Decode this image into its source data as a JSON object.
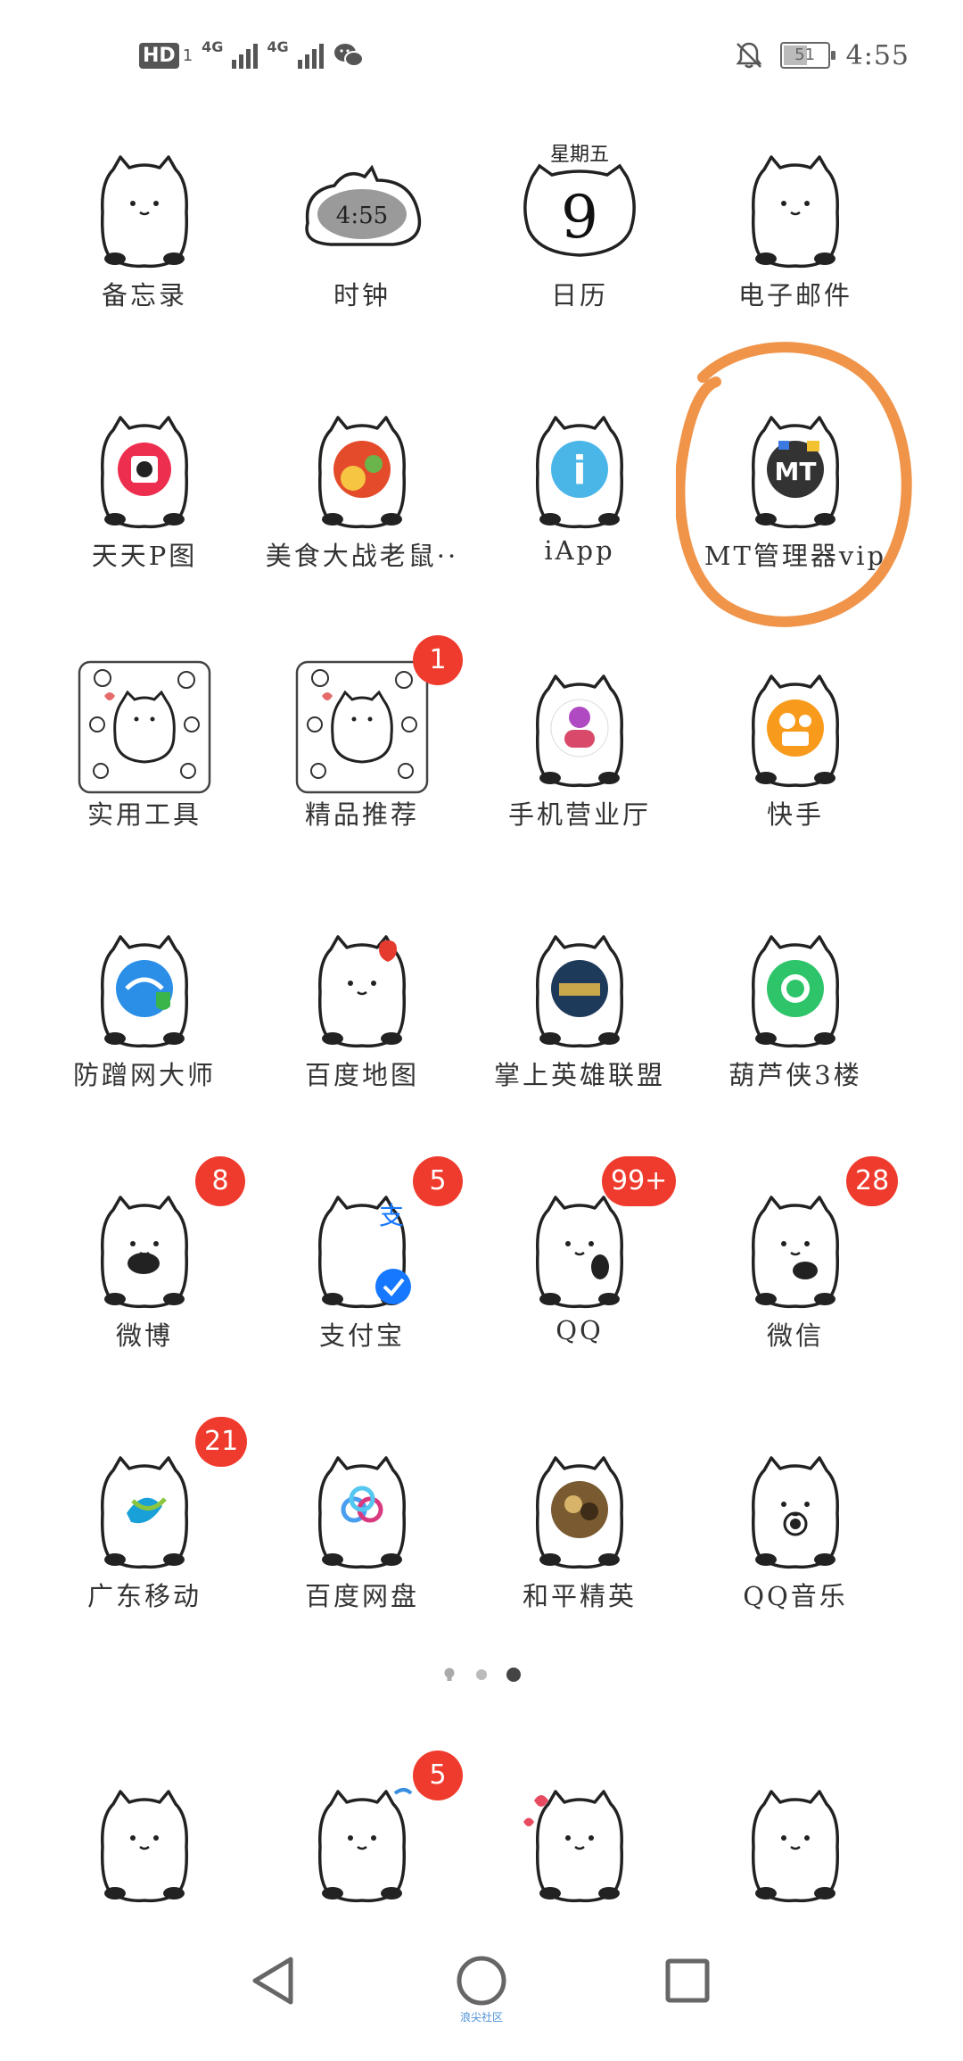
{
  "status_bar": {
    "hd": "HD",
    "sim": "1",
    "net1": "4G",
    "net2": "4G",
    "battery": "51",
    "time": "4:55"
  },
  "apps": [
    {
      "label": "备忘录",
      "icon": "cat-memo-icon"
    },
    {
      "label": "时钟",
      "icon": "cat-clock-icon",
      "clock_text": "4:55"
    },
    {
      "label": "日历",
      "icon": "cat-calendar-icon",
      "weekday": "星期五",
      "day": "9"
    },
    {
      "label": "电子邮件",
      "icon": "cat-email-icon"
    },
    {
      "label": "天天P图",
      "icon": "cat-ptu-icon"
    },
    {
      "label": "美食大战老鼠··",
      "icon": "cat-food-war-icon"
    },
    {
      "label": "iApp",
      "icon": "cat-iapp-icon",
      "glyph": "i"
    },
    {
      "label": "MT管理器vip",
      "icon": "cat-mt-manager-icon",
      "glyph": "MT"
    },
    {
      "label": "实用工具",
      "icon": "folder-tools-icon"
    },
    {
      "label": "精品推荐",
      "icon": "folder-recommend-icon",
      "badge": "1"
    },
    {
      "label": "手机营业厅",
      "icon": "cat-unicom-icon"
    },
    {
      "label": "快手",
      "icon": "cat-kuaishou-icon"
    },
    {
      "label": "防蹭网大师",
      "icon": "cat-wifi-guard-icon"
    },
    {
      "label": "百度地图",
      "icon": "cat-baidu-map-icon"
    },
    {
      "label": "掌上英雄联盟",
      "icon": "cat-lol-icon"
    },
    {
      "label": "葫芦侠3楼",
      "icon": "cat-huluxia-icon"
    },
    {
      "label": "微博",
      "icon": "cat-weibo-icon",
      "badge": "8"
    },
    {
      "label": "支付宝",
      "icon": "cat-alipay-icon",
      "badge": "5",
      "glyph": "支"
    },
    {
      "label": "QQ",
      "icon": "cat-qq-icon",
      "badge": "99+"
    },
    {
      "label": "微信",
      "icon": "cat-wechat-icon",
      "badge": "28"
    },
    {
      "label": "广东移动",
      "icon": "cat-china-mobile-icon",
      "badge": "21"
    },
    {
      "label": "百度网盘",
      "icon": "cat-baidu-pan-icon"
    },
    {
      "label": "和平精英",
      "icon": "cat-peace-elite-icon"
    },
    {
      "label": "QQ音乐",
      "icon": "cat-qq-music-icon"
    }
  ],
  "page_indicator": {
    "count": 3,
    "active": 2
  },
  "dock": [
    {
      "icon": "cat-dock-phone-icon"
    },
    {
      "icon": "cat-dock-messages-icon",
      "badge": "5"
    },
    {
      "icon": "cat-dock-love-icon"
    },
    {
      "icon": "cat-dock-camera-icon"
    }
  ],
  "nav_bar": {
    "caption": "浪尖社区"
  },
  "annotation": {
    "color": "#f0944a"
  }
}
